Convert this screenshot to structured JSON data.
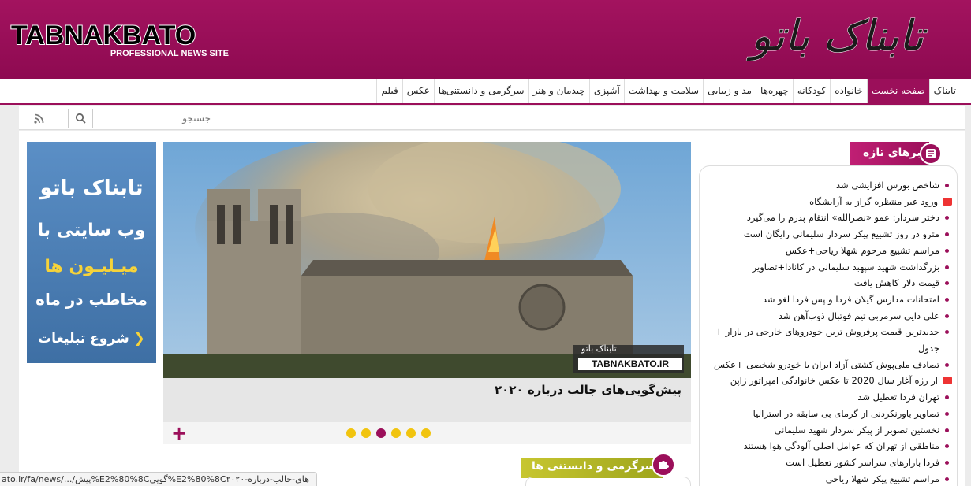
{
  "header": {
    "logo_en": "TABNAKBATO",
    "tagline": "PROFESSIONAL NEWS SITE",
    "logo_fa": "تابناک باتو",
    "colors": {
      "brand": "#9b0f5a",
      "accent_yellow": "#f1c40f",
      "section_green": "#b8b826"
    }
  },
  "nav": {
    "items": [
      {
        "label": "تابناک"
      },
      {
        "label": "صفحه نخست",
        "active": true
      },
      {
        "label": "خانواده"
      },
      {
        "label": "کودکانه"
      },
      {
        "label": "چهره‌ها"
      },
      {
        "label": "مد و زیبایی"
      },
      {
        "label": "سلامت و بهداشت"
      },
      {
        "label": "آشپزی"
      },
      {
        "label": "چیدمان و هنر"
      },
      {
        "label": "سرگرمی و دانستنی‌ها"
      },
      {
        "label": "عکس"
      },
      {
        "label": "فیلم"
      }
    ]
  },
  "search": {
    "placeholder": "جستجو",
    "icon": "search-icon",
    "rss_icon": "rss-icon"
  },
  "ad": {
    "line1": "تابناک باتو",
    "line2": "وب سایتی با",
    "line3": "میـلیـون ها",
    "line4": "مخاطب در ماه",
    "cta": "شروع تبلیغات",
    "cta_arrow": "❯"
  },
  "slider": {
    "watermark_fa": "تابناک باتو",
    "watermark_en": "TABNAKBATO.IR",
    "caption": "پیش‌گویی‌های جالب درباره ۲۰۲۰",
    "plus_label": "+",
    "dot_count": 6,
    "active_dot": 2
  },
  "section": {
    "title": "سرگرمی و دانستنی ها",
    "icon": "puzzle-icon"
  },
  "news": {
    "title": "خبرهای تازه",
    "icon": "newspaper-icon",
    "items": [
      {
        "text": "شاخص بورس افزایشی شد"
      },
      {
        "text": "ورود عیر منتظره گراز به آرایشگاه",
        "media": "video-icon"
      },
      {
        "text": "دختر سردار: عمو «نصرالله» انتقام پدرم را می‌گیرد"
      },
      {
        "text": "مترو در روز تشییع پیکر سردار سلیمانی رایگان است"
      },
      {
        "text": "مراسم تشییع مرحوم شهلا ریاحی+عکس"
      },
      {
        "text": "بزرگداشت شهید سپهبد سلیمانی در کانادا+تصاویر"
      },
      {
        "text": "قیمت دلار کاهش یافت"
      },
      {
        "text": "امتحانات مدارس گیلان فردا و پس فردا لغو شد"
      },
      {
        "text": "علی دایی سرمربی تیم فوتبال ذوب‌آهن شد"
      },
      {
        "text": "جدیدترین قیمت پرفروش ترین خودروهای خارجی در بازار + جدول",
        "wrap": true
      },
      {
        "text": "تصادف ملی‌پوش کشتی آزاد ایران با خودرو شخصی +عکس"
      },
      {
        "text": "از رژه آغاز سال 2020 تا عکس خانوادگی امپراتور ژاپن",
        "media": "camera-icon"
      },
      {
        "text": "تهران فردا تعطیل شد"
      },
      {
        "text": "تصاویر باورنکردنی از گرمای بی سابقه در استرالیا"
      },
      {
        "text": "نخستین تصویر از پیکر سردار شهید سلیمانی"
      },
      {
        "text": "مناطقی از تهران که عوامل اصلی آلودگی هوا هستند"
      },
      {
        "text": "فردا بازارهای سراسر کشور تعطیل است"
      },
      {
        "text": "مراسم تشییع پیکر شهلا ریاحی"
      }
    ]
  },
  "status": {
    "url": "ato.ir/fa/news/.../پیش%E2%80%8Cگویی%E2%80%8Cهای-جالب-درباره-۲۰۲۰"
  }
}
